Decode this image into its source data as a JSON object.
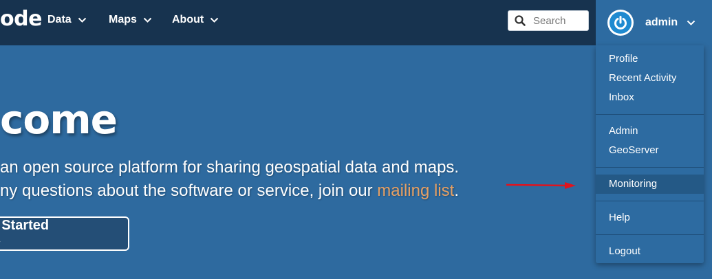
{
  "brand": "ode",
  "nav": {
    "data_label": "Data",
    "maps_label": "Maps",
    "about_label": "About"
  },
  "search": {
    "placeholder": "Search"
  },
  "user": {
    "name": "admin"
  },
  "hero": {
    "title": "come",
    "line1": "an open source platform for sharing geospatial data and maps.",
    "line2_prefix": "ny questions about the software or service, join our ",
    "line2_link": "mailing list",
    "line2_suffix": ".",
    "cta_label": "t Started »"
  },
  "dropdown": {
    "items": [
      "Profile",
      "Recent Activity",
      "Inbox",
      "Admin",
      "GeoServer",
      "Monitoring",
      "Help",
      "Logout"
    ],
    "active_item": "Monitoring"
  },
  "colors": {
    "navbar": "#17334f",
    "background": "#2e6a9f",
    "dropdown": "#2d6ba1",
    "link": "#e6a064",
    "annotation_arrow": "#e0141e"
  },
  "icons": {
    "search": "search-icon",
    "chevron": "chevron-down-icon",
    "avatar": "power-icon",
    "annotation": "arrow-right-icon"
  }
}
